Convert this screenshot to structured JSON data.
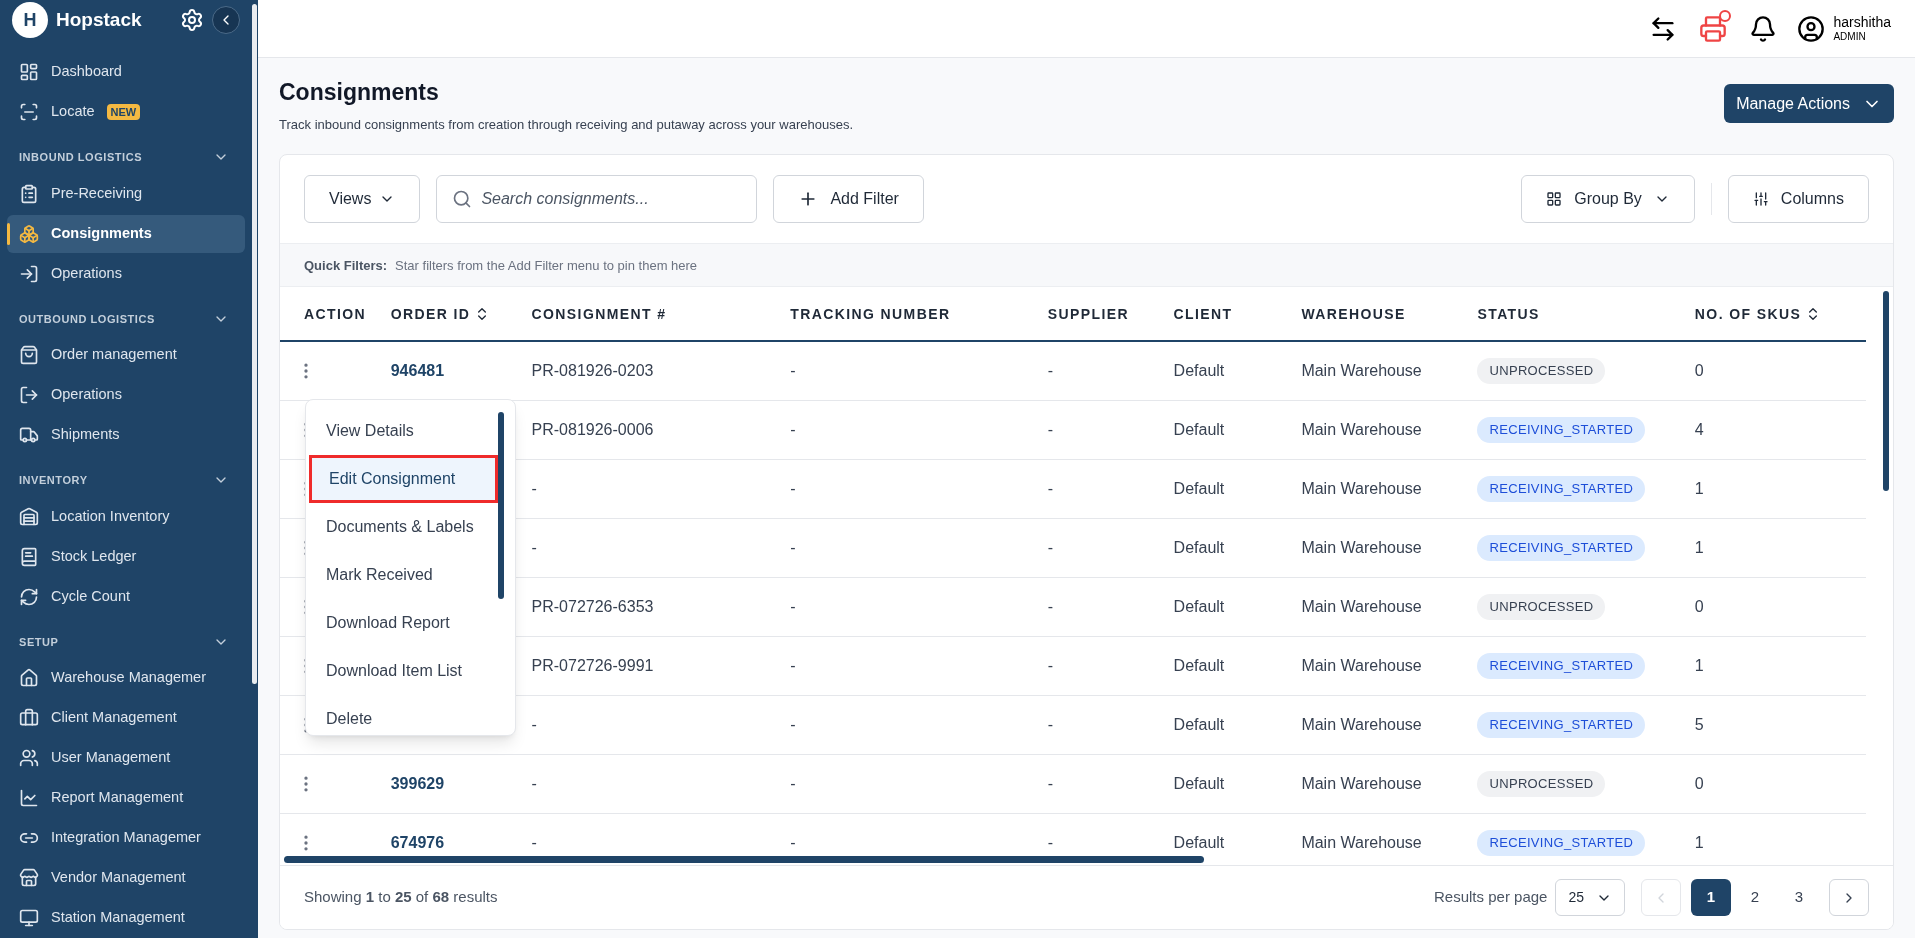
{
  "brand": {
    "name": "Hopstack",
    "logo_letter": "H"
  },
  "sidebar": {
    "sections": [
      {
        "items": [
          {
            "label": "Dashboard",
            "selected": false
          },
          {
            "label": "Locate",
            "selected": false,
            "badge": "NEW"
          }
        ]
      },
      {
        "title": "INBOUND LOGISTICS",
        "items": [
          {
            "label": "Pre-Receiving",
            "selected": false
          },
          {
            "label": "Consignments",
            "selected": true
          },
          {
            "label": "Operations",
            "selected": false
          }
        ]
      },
      {
        "title": "OUTBOUND LOGISTICS",
        "items": [
          {
            "label": "Order management",
            "selected": false
          },
          {
            "label": "Operations",
            "selected": false
          },
          {
            "label": "Shipments",
            "selected": false
          }
        ]
      },
      {
        "title": "INVENTORY",
        "items": [
          {
            "label": "Location Inventory",
            "selected": false
          },
          {
            "label": "Stock Ledger",
            "selected": false
          },
          {
            "label": "Cycle Count",
            "selected": false
          }
        ]
      },
      {
        "title": "SETUP",
        "items": [
          {
            "label": "Warehouse Managemer",
            "selected": false
          },
          {
            "label": "Client Management",
            "selected": false
          },
          {
            "label": "User Management",
            "selected": false
          },
          {
            "label": "Report Management",
            "selected": false
          },
          {
            "label": "Integration Managemer",
            "selected": false
          },
          {
            "label": "Vendor Management",
            "selected": false
          },
          {
            "label": "Station Management",
            "selected": false
          }
        ]
      }
    ]
  },
  "user": {
    "name": "harshitha",
    "role": "ADMIN"
  },
  "page": {
    "title": "Consignments",
    "subtitle": "Track inbound consignments from creation through receiving and putaway across your warehouses.",
    "action": "Manage Actions"
  },
  "toolbar": {
    "views": "Views",
    "search_placeholder": "Search consignments...",
    "add_filter": "Add Filter",
    "group_by": "Group By",
    "columns": "Columns"
  },
  "quick_filters": {
    "label": "Quick Filters:",
    "hint": "Star filters from the Add Filter menu to pin them here"
  },
  "table": {
    "columns": [
      {
        "label": "ACTION",
        "sortable": false
      },
      {
        "label": "ORDER ID",
        "sortable": true
      },
      {
        "label": "CONSIGNMENT #",
        "sortable": false
      },
      {
        "label": "TRACKING NUMBER",
        "sortable": false
      },
      {
        "label": "SUPPLIER",
        "sortable": false
      },
      {
        "label": "CLIENT",
        "sortable": false
      },
      {
        "label": "WAREHOUSE",
        "sortable": false
      },
      {
        "label": "STATUS",
        "sortable": false
      },
      {
        "label": "NO. OF SKUS",
        "sortable": true
      }
    ],
    "rows": [
      {
        "order_id": "946481",
        "consignment": "PR-081926-0203",
        "tracking": "-",
        "supplier": "-",
        "client": "Default",
        "warehouse": "Main Warehouse",
        "status": {
          "text": "UNPROCESSED",
          "kind": "neutral"
        },
        "skus": "0"
      },
      {
        "consignment": "PR-081926-0006",
        "tracking": "-",
        "supplier": "-",
        "client": "Default",
        "warehouse": "Main Warehouse",
        "status": {
          "text": "RECEIVING_STARTED",
          "kind": "info"
        },
        "skus": "4"
      },
      {
        "consignment": "-",
        "tracking": "-",
        "supplier": "-",
        "client": "Default",
        "warehouse": "Main Warehouse",
        "status": {
          "text": "RECEIVING_STARTED",
          "kind": "info"
        },
        "skus": "1"
      },
      {
        "consignment": "-",
        "tracking": "-",
        "supplier": "-",
        "client": "Default",
        "warehouse": "Main Warehouse",
        "status": {
          "text": "RECEIVING_STARTED",
          "kind": "info"
        },
        "skus": "1"
      },
      {
        "consignment": "PR-072726-6353",
        "tracking": "-",
        "supplier": "-",
        "client": "Default",
        "warehouse": "Main Warehouse",
        "status": {
          "text": "UNPROCESSED",
          "kind": "neutral"
        },
        "skus": "0"
      },
      {
        "consignment": "PR-072726-9991",
        "tracking": "-",
        "supplier": "-",
        "client": "Default",
        "warehouse": "Main Warehouse",
        "status": {
          "text": "RECEIVING_STARTED",
          "kind": "info"
        },
        "skus": "1"
      },
      {
        "consignment": "-",
        "tracking": "-",
        "supplier": "-",
        "client": "Default",
        "warehouse": "Main Warehouse",
        "status": {
          "text": "RECEIVING_STARTED",
          "kind": "info"
        },
        "skus": "5"
      },
      {
        "order_id": "399629",
        "consignment": "-",
        "tracking": "-",
        "supplier": "-",
        "client": "Default",
        "warehouse": "Main Warehouse",
        "status": {
          "text": "UNPROCESSED",
          "kind": "neutral"
        },
        "skus": "0"
      },
      {
        "order_id": "674976",
        "consignment": "-",
        "tracking": "-",
        "supplier": "-",
        "client": "Default",
        "warehouse": "Main Warehouse",
        "status": {
          "text": "RECEIVING_STARTED",
          "kind": "info"
        },
        "skus": "1"
      }
    ]
  },
  "action_menu": {
    "items": [
      {
        "label": "View Details",
        "selected": false
      },
      {
        "label": "Edit Consignment",
        "selected": true
      },
      {
        "label": "Documents & Labels",
        "selected": false
      },
      {
        "label": "Mark Received",
        "selected": false
      },
      {
        "label": "Download Report",
        "selected": false
      },
      {
        "label": "Download Item List",
        "selected": false
      },
      {
        "label": "Delete",
        "selected": false
      }
    ]
  },
  "footer": {
    "summary": "Showing **1** to **25** of **68** results",
    "per_page_label": "Results per page",
    "per_page": "25",
    "pages": [
      {
        "label": "1",
        "selected": true
      },
      {
        "label": "2",
        "selected": false
      },
      {
        "label": "3",
        "selected": false
      }
    ]
  }
}
